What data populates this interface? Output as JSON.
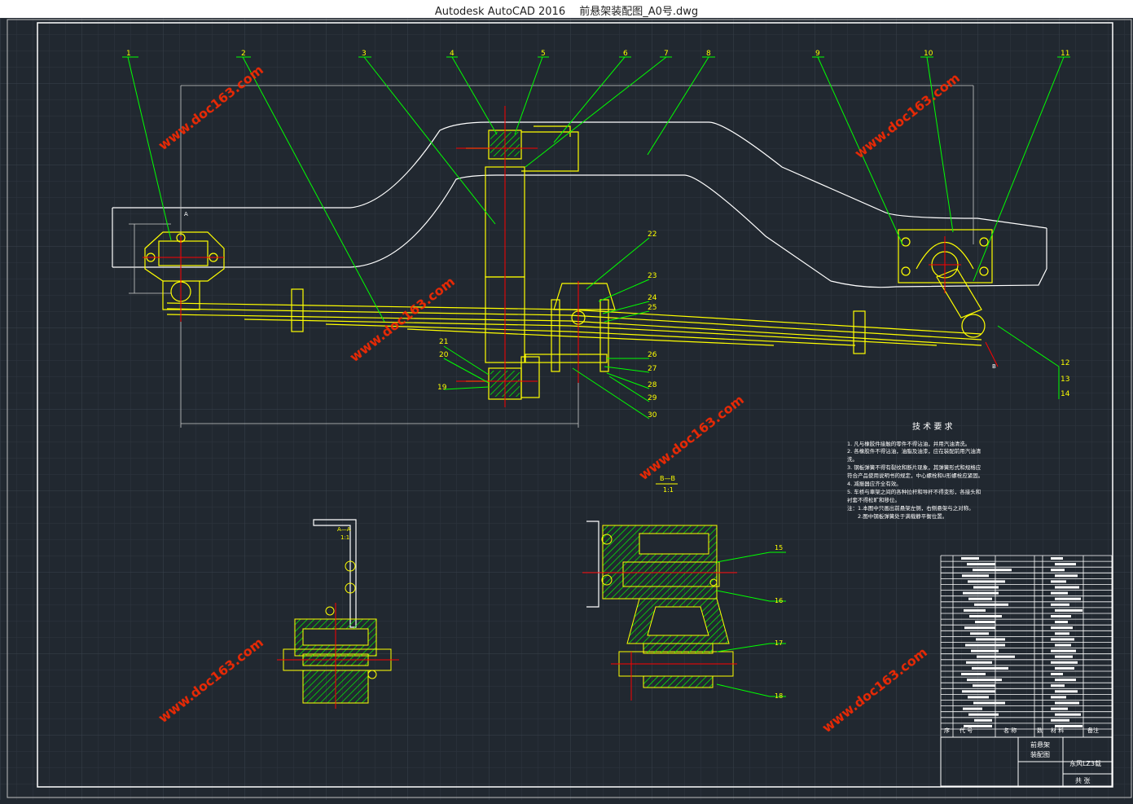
{
  "app": {
    "title": "Autodesk AutoCAD 2016 　前悬架装配图_A0号.dwg",
    "sys_icon": "自"
  },
  "colors": {
    "background": "#212830",
    "frame": "#ffffff",
    "geometry": "#ffff00",
    "leader": "#00ff00",
    "centerline": "#ff0000",
    "hatch": "#00ff00",
    "watermark": "#ff2a00"
  },
  "callouts_top": [
    "1",
    "2",
    "3",
    "4",
    "5",
    "6",
    "7",
    "8",
    "9",
    "10",
    "11"
  ],
  "callouts_right": [
    "22",
    "23",
    "24",
    "25",
    "26",
    "27",
    "28",
    "29",
    "30"
  ],
  "callouts_left": [
    "21",
    "20",
    "19"
  ],
  "callouts_rear": [
    "12",
    "13",
    "14"
  ],
  "section_labels": {
    "bb": "B—B",
    "bb_scale": "1:1",
    "aa": "A—A",
    "aa_scale": "1:1",
    "b_mark": "B",
    "a_mark": "A"
  },
  "section_callouts": [
    "15",
    "16",
    "17",
    "18"
  ],
  "tech": {
    "heading": "技 术 要 求",
    "lines": [
      "1. 凡与橡胶件接触的零件不得沾油，并用汽油清洗。",
      "2. 各橡胶件不得沾油，油脂及油漆，应在装配前用汽油清",
      "洗。",
      "3. 钢板弹簧不得有裂纹和断片现象，其弹簧形式和规格应",
      "符合产品使用说明书的规定，中心螺栓和U形螺栓应紧固。",
      "4. 减振器应齐全有效。",
      "5. 车桥与車架之间的各种拉杆和导杆不得变形，各接头和",
      "衬套不得松旷和移位。",
      "注：1.本图中只画出前悬架左侧，右侧悬架与之对称。",
      "　　2.图中钢板弹簧处于满载静平衡位置。"
    ]
  },
  "titleblock": {
    "header": [
      "序",
      "代 号",
      "名 称",
      "数",
      "材 料",
      "备注"
    ],
    "drawing_name_1": "前悬架",
    "drawing_name_2": "装配图",
    "company": "东风LZ3载",
    "sheet": "共 张"
  },
  "watermarks": [
    "www.doc163.com",
    "www.doc163.com",
    "www.doc163.com",
    "www.doc163.com",
    "www.doc163.com",
    "www.doc163.com",
    "www.doc163.com"
  ]
}
